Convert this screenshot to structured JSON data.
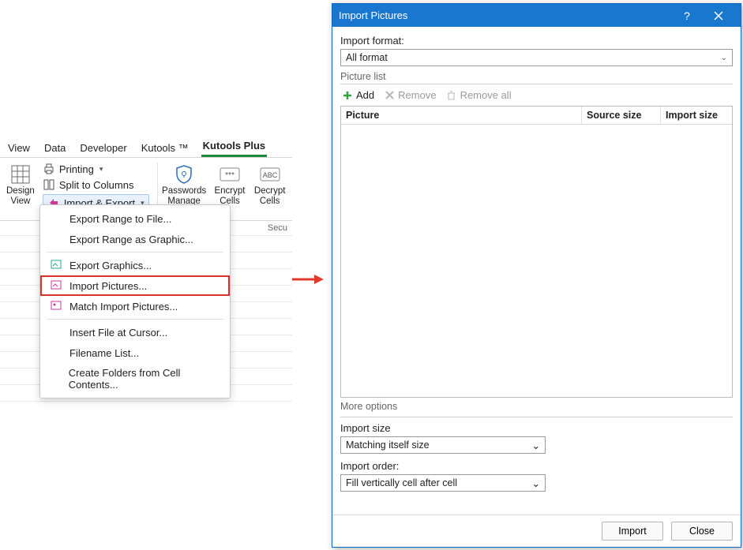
{
  "ribbon": {
    "tabs": [
      "View",
      "Data",
      "Developer",
      "Kutools ™",
      "Kutools Plus"
    ],
    "active_tab": "Kutools Plus",
    "design_view": "Design\nView",
    "printing": "Printing",
    "split_cols": "Split to Columns",
    "import_export": "Import & Export",
    "passwords_manage": "Passwords\nManage",
    "encrypt_cells": "Encrypt\nCells",
    "decrypt_cells": "Decrypt\nCells",
    "group_label": "Secu"
  },
  "dropdown": {
    "items": [
      "Export Range to File...",
      "Export Range as Graphic...",
      "Export Graphics...",
      "Import Pictures...",
      "Match Import Pictures...",
      "Insert File at Cursor...",
      "Filename List...",
      "Create Folders from Cell Contents..."
    ],
    "selected_index": 3
  },
  "dialog": {
    "title": "Import Pictures",
    "import_format_label": "Import format:",
    "import_format_value": "All format",
    "picture_list_label": "Picture list",
    "toolbar": {
      "add": "Add",
      "remove": "Remove",
      "remove_all": "Remove all"
    },
    "columns": {
      "picture": "Picture",
      "source_size": "Source size",
      "import_size": "Import size"
    },
    "more_options": "More options",
    "import_size_label": "Import size",
    "import_size_value": "Matching itself size",
    "import_order_label": "Import order:",
    "import_order_value": "Fill vertically cell after cell",
    "buttons": {
      "import": "Import",
      "close": "Close"
    }
  }
}
